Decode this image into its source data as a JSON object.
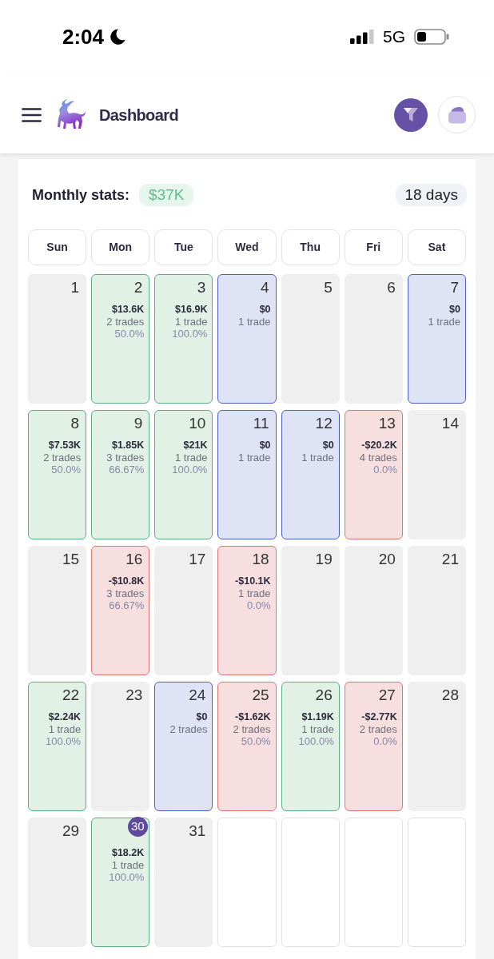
{
  "status_bar": {
    "time": "2:04",
    "network": "5G"
  },
  "header": {
    "title": "Dashboard"
  },
  "monthly_stats": {
    "label": "Monthly stats:",
    "total": "$37K",
    "days": "18 days"
  },
  "weekdays": [
    "Sun",
    "Mon",
    "Tue",
    "Wed",
    "Thu",
    "Fri",
    "Sat"
  ],
  "weeks": [
    [
      {
        "kind": "none",
        "day": "1",
        "today": false
      },
      {
        "kind": "profit",
        "day": "2",
        "pnl": "$13.6K",
        "trades": "2 trades",
        "win_rate": "50.0%",
        "today": false
      },
      {
        "kind": "profit",
        "day": "3",
        "pnl": "$16.9K",
        "trades": "1 trade",
        "win_rate": "100.0%",
        "today": false
      },
      {
        "kind": "breakeven",
        "day": "4",
        "pnl": "$0",
        "trades": "1 trade",
        "today": false
      },
      {
        "kind": "none",
        "day": "5",
        "today": false
      },
      {
        "kind": "none",
        "day": "6",
        "today": false
      },
      {
        "kind": "breakeven",
        "day": "7",
        "pnl": "$0",
        "trades": "1 trade",
        "today": false
      }
    ],
    [
      {
        "kind": "profit",
        "day": "8",
        "pnl": "$7.53K",
        "trades": "2 trades",
        "win_rate": "50.0%",
        "today": false
      },
      {
        "kind": "profit",
        "day": "9",
        "pnl": "$1.85K",
        "trades": "3 trades",
        "win_rate": "66.67%",
        "today": false
      },
      {
        "kind": "profit",
        "day": "10",
        "pnl": "$21K",
        "trades": "1 trade",
        "win_rate": "100.0%",
        "today": false
      },
      {
        "kind": "breakeven",
        "day": "11",
        "pnl": "$0",
        "trades": "1 trade",
        "today": false
      },
      {
        "kind": "breakeven",
        "day": "12",
        "pnl": "$0",
        "trades": "1 trade",
        "today": false
      },
      {
        "kind": "loss",
        "day": "13",
        "pnl": "-$20.2K",
        "trades": "4 trades",
        "win_rate": "0.0%",
        "today": false
      },
      {
        "kind": "none",
        "day": "14",
        "today": false
      }
    ],
    [
      {
        "kind": "none",
        "day": "15",
        "today": false
      },
      {
        "kind": "loss",
        "day": "16",
        "pnl": "-$10.8K",
        "trades": "3 trades",
        "win_rate": "66.67%",
        "today": false
      },
      {
        "kind": "none",
        "day": "17",
        "today": false
      },
      {
        "kind": "loss",
        "day": "18",
        "pnl": "-$10.1K",
        "trades": "1 trade",
        "win_rate": "0.0%",
        "today": false
      },
      {
        "kind": "none",
        "day": "19",
        "today": false
      },
      {
        "kind": "none",
        "day": "20",
        "today": false
      },
      {
        "kind": "none",
        "day": "21",
        "today": false
      }
    ],
    [
      {
        "kind": "profit",
        "day": "22",
        "pnl": "$2.24K",
        "trades": "1 trade",
        "win_rate": "100.0%",
        "today": false
      },
      {
        "kind": "none",
        "day": "23",
        "today": false
      },
      {
        "kind": "breakeven",
        "day": "24",
        "pnl": "$0",
        "trades": "2 trades",
        "today": false
      },
      {
        "kind": "loss",
        "day": "25",
        "pnl": "-$1.62K",
        "trades": "2 trades",
        "win_rate": "50.0%",
        "today": false
      },
      {
        "kind": "profit",
        "day": "26",
        "pnl": "$1.19K",
        "trades": "1 trade",
        "win_rate": "100.0%",
        "today": false
      },
      {
        "kind": "loss",
        "day": "27",
        "pnl": "-$2.77K",
        "trades": "2 trades",
        "win_rate": "0.0%",
        "today": false
      },
      {
        "kind": "none",
        "day": "28",
        "today": false
      }
    ],
    [
      {
        "kind": "none",
        "day": "29",
        "today": false
      },
      {
        "kind": "profit",
        "day": "30",
        "pnl": "$18.2K",
        "trades": "1 trade",
        "win_rate": "100.0%",
        "today": true
      },
      {
        "kind": "none",
        "day": "31",
        "today": false
      },
      {
        "kind": "blank"
      },
      {
        "kind": "blank"
      },
      {
        "kind": "blank"
      },
      {
        "kind": "blank"
      }
    ]
  ]
}
